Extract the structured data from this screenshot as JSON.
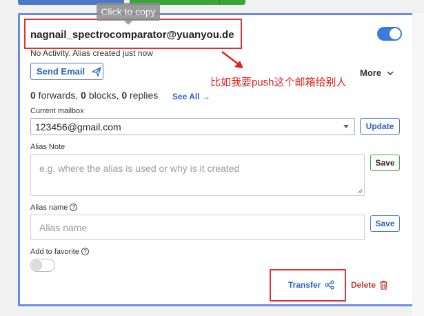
{
  "tooltip": {
    "text": "Click to copy"
  },
  "alias": {
    "email": "nagnail_spectrocomparator@yuanyou.de",
    "activity": "No Activity. Alias created just now",
    "enabled": true
  },
  "actions": {
    "send_email": "Send Email",
    "more": "More"
  },
  "annotation": {
    "text": "比如我要push这个邮箱给别人"
  },
  "stats": {
    "forwards_count": "0",
    "forwards_label": " forwards, ",
    "blocks_count": "0",
    "blocks_label": " blocks, ",
    "replies_count": "0",
    "replies_label": " replies",
    "see_all": "See All  →"
  },
  "mailbox": {
    "label": "Current mailbox",
    "value": "123456@gmail.com",
    "update_label": "Update"
  },
  "note": {
    "label": "Alias Note",
    "placeholder": "e.g. where the alias is used or why is it created",
    "save_label": "Save"
  },
  "name": {
    "label": "Alias name",
    "help": "?",
    "placeholder": "Alias name",
    "save_label": "Save"
  },
  "favorite": {
    "label": "Add to favorite",
    "help": "?",
    "enabled": false
  },
  "footer": {
    "transfer_label": "Transfer",
    "delete_label": "Delete"
  },
  "colors": {
    "accent": "#3a7ad9",
    "link": "#2b63c4",
    "annotation": "#e02020",
    "danger": "#c0392b",
    "card_border": "#6b8ce0"
  }
}
